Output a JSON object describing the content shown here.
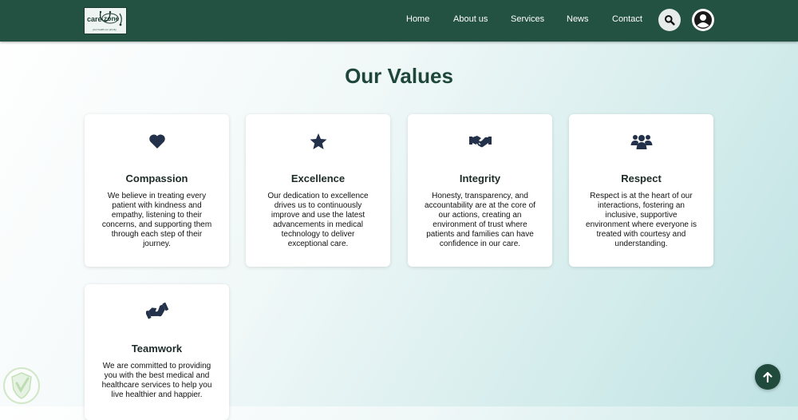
{
  "nav": {
    "logo": {
      "word1": "care",
      "word2": "zone",
      "tagline": "your health our priority"
    },
    "links": [
      "Home",
      "About us",
      "Services",
      "News",
      "Contact"
    ],
    "search_icon": "search-icon",
    "user_icon": "user-circle-icon"
  },
  "values": {
    "title": "Our Values",
    "cards": [
      {
        "icon": "heart-icon",
        "title": "Compassion",
        "text": "We believe in treating every patient with kindness and empathy, listening to their concerns, and supporting them through each step of their journey."
      },
      {
        "icon": "star-icon",
        "title": "Excellence",
        "text": "Our dedication to excellence drives us to continuously improve and use the latest advancements in medical technology to deliver exceptional care."
      },
      {
        "icon": "handshake-icon",
        "title": "Integrity",
        "text": "Honesty, transparency, and accountability are at the core of our actions, creating an environment of trust where patients and families can have confidence in our care."
      },
      {
        "icon": "users-icon",
        "title": "Respect",
        "text": "Respect is at the heart of our interactions, fostering an inclusive, supportive environment where everyone is treated with courtesy and understanding."
      },
      {
        "icon": "handshake-angled-icon",
        "title": "Teamwork",
        "text": "We are committed to providing you with the best medical and healthcare services to help you live healthier and happier."
      }
    ]
  },
  "scroll_top_icon": "arrow-up-icon",
  "colors": {
    "primary": "#245242",
    "heading": "#1e4739",
    "icon": "#23324a"
  }
}
